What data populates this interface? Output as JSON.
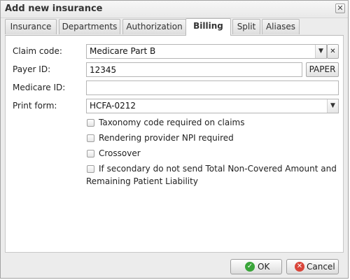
{
  "window": {
    "title": "Add new insurance",
    "close_glyph": "✕"
  },
  "tabs": [
    {
      "label": "Insurance",
      "active": false
    },
    {
      "label": "Departments",
      "active": false
    },
    {
      "label": "Authorization",
      "active": false
    },
    {
      "label": "Billing",
      "active": true
    },
    {
      "label": "Split",
      "active": false
    },
    {
      "label": "Aliases",
      "active": false
    }
  ],
  "form": {
    "claim_code": {
      "label": "Claim code:",
      "value": "Medicare Part B",
      "clear_glyph": "✕"
    },
    "payer_id": {
      "label": "Payer ID:",
      "value": "12345",
      "button_label": "PAPER"
    },
    "medicare_id": {
      "label": "Medicare ID:",
      "value": ""
    },
    "print_form": {
      "label": "Print form:",
      "value": "HCFA-0212"
    },
    "dropdown_glyph": "▼"
  },
  "checkboxes": [
    {
      "label": "Taxonomy code required on claims",
      "checked": false
    },
    {
      "label": "Rendering provider NPI required",
      "checked": false
    },
    {
      "label": "Crossover",
      "checked": false
    },
    {
      "label": "If secondary do not send Total Non-Covered Amount and",
      "label_line2": "Remaining Patient Liability",
      "checked": false
    }
  ],
  "footer": {
    "ok_label": "OK",
    "ok_glyph": "✓",
    "cancel_label": "Cancel",
    "cancel_glyph": "✕"
  },
  "colors": {
    "ok_icon": "#3aa53a",
    "cancel_icon": "#d9453a"
  }
}
